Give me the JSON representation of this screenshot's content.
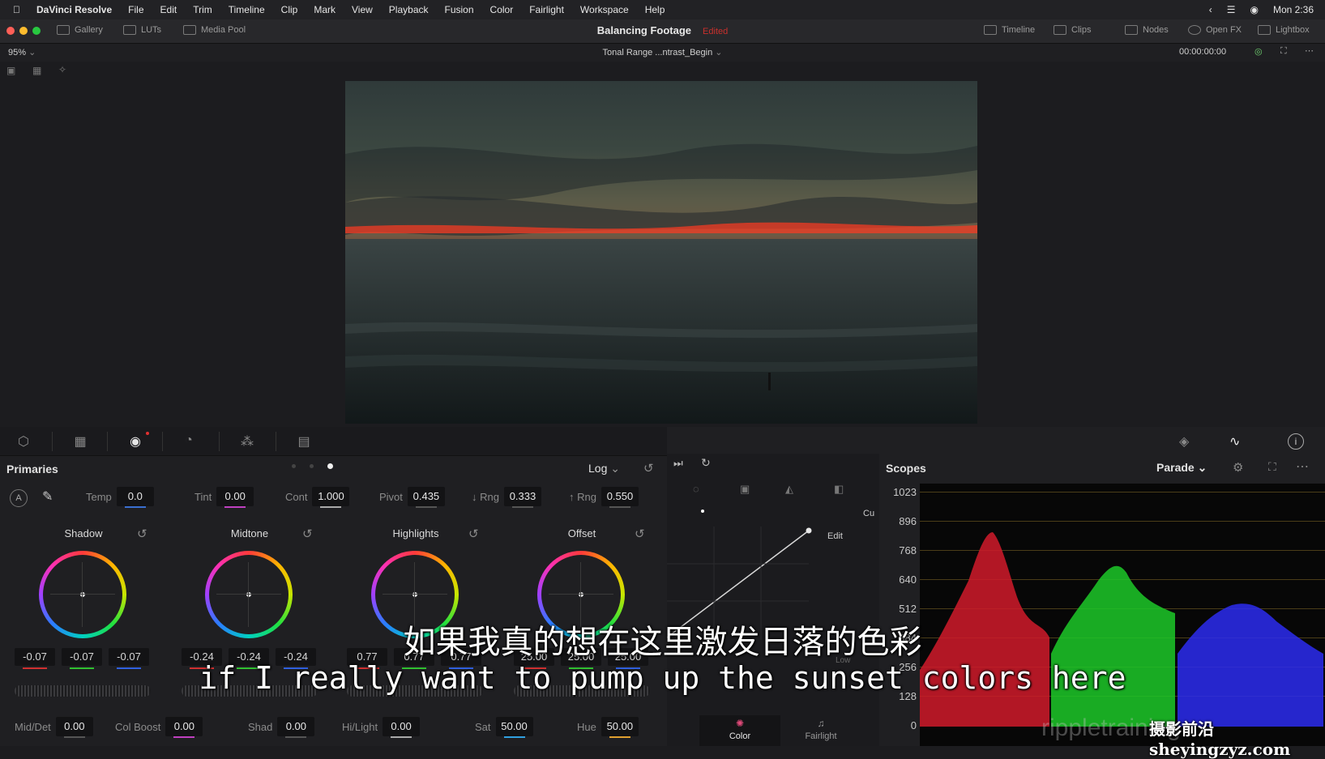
{
  "menubar": {
    "app_name": "DaVinci Resolve",
    "items": [
      "File",
      "Edit",
      "Trim",
      "Timeline",
      "Clip",
      "Mark",
      "View",
      "Playback",
      "Fusion",
      "Color",
      "Fairlight",
      "Workspace",
      "Help"
    ],
    "clock": "Mon 2:36"
  },
  "toolbar": {
    "gallery": "Gallery",
    "luts": "LUTs",
    "media_pool": "Media Pool",
    "project_title": "Balancing Footage",
    "project_status": "Edited",
    "timeline": "Timeline",
    "clips": "Clips",
    "nodes": "Nodes",
    "open_fx": "Open FX",
    "lightbox": "Lightbox"
  },
  "viewer": {
    "zoom": "95%",
    "clip_name": "Tonal Range ...ntrast_Begin",
    "timecode": "00:00:00:00"
  },
  "primaries": {
    "title": "Primaries",
    "mode": "Log",
    "params": [
      {
        "label": "Temp",
        "value": "0.0"
      },
      {
        "label": "Tint",
        "value": "0.00"
      },
      {
        "label": "Cont",
        "value": "1.000"
      },
      {
        "label": "Pivot",
        "value": "0.435"
      },
      {
        "label": "↓ Rng",
        "value": "0.333"
      },
      {
        "label": "↑ Rng",
        "value": "0.550"
      }
    ],
    "wheels": [
      {
        "label": "Shadow",
        "values": [
          "-0.07",
          "-0.07",
          "-0.07"
        ]
      },
      {
        "label": "Midtone",
        "values": [
          "-0.24",
          "-0.24",
          "-0.24"
        ]
      },
      {
        "label": "Highlights",
        "values": [
          "0.77",
          "0.77",
          "0.77"
        ]
      },
      {
        "label": "Offset",
        "values": [
          "25.00",
          "25.00",
          "25.00"
        ]
      }
    ],
    "bottom": [
      {
        "label": "Mid/Det",
        "value": "0.00"
      },
      {
        "label": "Col Boost",
        "value": "0.00"
      },
      {
        "label": "Shad",
        "value": "0.00"
      },
      {
        "label": "Hi/Light",
        "value": "0.00"
      },
      {
        "label": "Sat",
        "value": "50.00"
      },
      {
        "label": "Hue",
        "value": "50.00"
      }
    ]
  },
  "curves": {
    "edit_label": "Edit",
    "low_label": "Low",
    "cut_label": "Cu"
  },
  "scopes": {
    "title": "Scopes",
    "mode": "Parade",
    "ticks": [
      "1023",
      "896",
      "768",
      "640",
      "512",
      "384",
      "256",
      "128",
      "0"
    ]
  },
  "pages": {
    "color": "Color",
    "fairlight": "Fairlight"
  },
  "subtitles": {
    "chinese": "如果我真的想在这里激发日落的色彩",
    "english": "if I really want to pump up the sunset colors here"
  },
  "watermark": {
    "text": "摄影前沿sheyingzyz.com",
    "ripple": "rippletraining"
  }
}
